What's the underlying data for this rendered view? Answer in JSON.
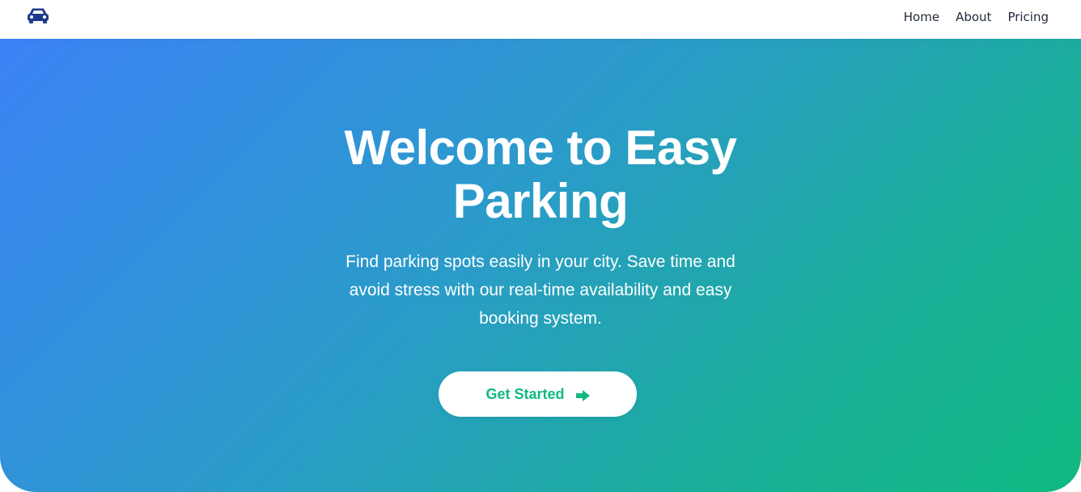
{
  "navbar": {
    "logo_icon": "car-icon",
    "links": [
      {
        "label": "Home"
      },
      {
        "label": "About"
      },
      {
        "label": "Pricing"
      }
    ]
  },
  "hero": {
    "title": "Welcome to Easy Parking",
    "description": "Find parking spots easily in your city. Save time and avoid stress with our real-time availability and easy booking system.",
    "cta_label": "Get Started",
    "cta_icon": "arrow-right-icon"
  },
  "colors": {
    "brand_dark": "#1e3a8a",
    "gradient_start": "#3b82f6",
    "gradient_end": "#10b981",
    "nav_text": "#1f2937",
    "cta_text": "#10b981"
  }
}
